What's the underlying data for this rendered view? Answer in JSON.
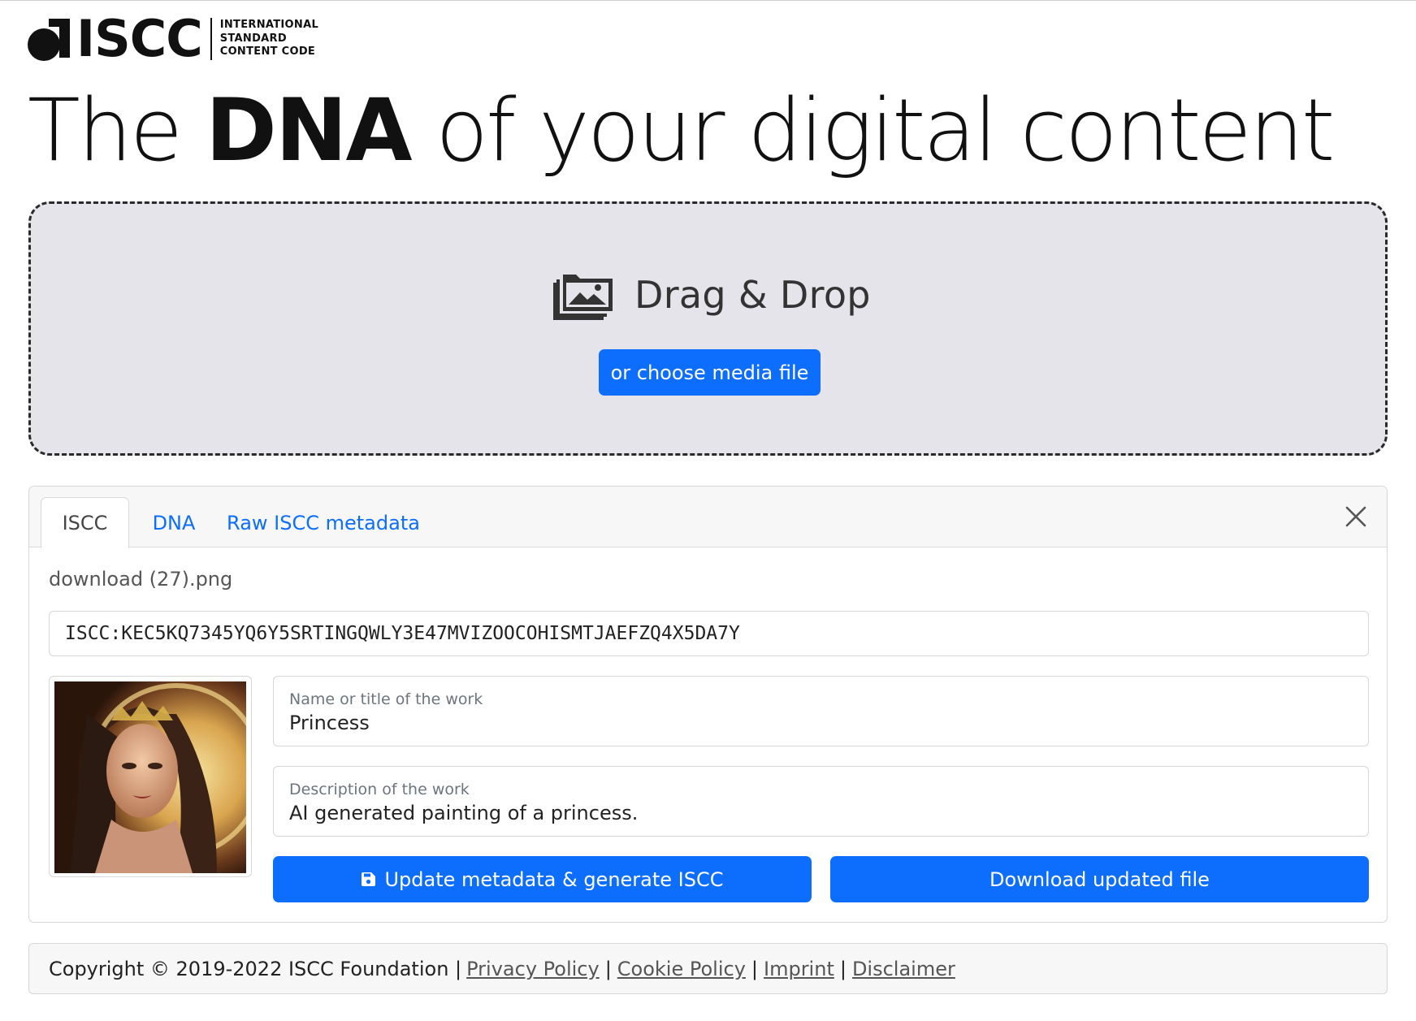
{
  "logo": {
    "word": "ISCC",
    "tagline": [
      "INTERNATIONAL",
      "STANDARD",
      "CONTENT CODE"
    ]
  },
  "headline": {
    "part1": "The ",
    "bold": "DNA",
    "part2": " of your digital content"
  },
  "dropzone": {
    "icon": "images-icon",
    "title": "Drag & Drop",
    "button_label": "or choose media file"
  },
  "tabs": [
    {
      "label": "ISCC",
      "active": true
    },
    {
      "label": "DNA",
      "active": false
    },
    {
      "label": "Raw ISCC metadata",
      "active": false
    }
  ],
  "result": {
    "filename": "download (27).png",
    "iscc_code": "ISCC:KEC5KQ7345YQ6Y5SRTINGQWLY3E47MVIZOOCOHISMTJAEFZQ4X5DA7Y",
    "name_label": "Name or title of the work",
    "name_value": "Princess",
    "description_label": "Description of the work",
    "description_value": "AI generated painting of a princess.",
    "update_button": "Update metadata & generate ISCC",
    "download_button": "Download updated file"
  },
  "footer": {
    "copyright": "Copyright © 2019-2022 ISCC Foundation |",
    "links": [
      "Privacy Policy",
      "Cookie Policy",
      "Imprint",
      "Disclaimer"
    ]
  },
  "colors": {
    "primary": "#0d6efd",
    "dropzone_bg": "#e4e4ea",
    "text": "#212529"
  }
}
